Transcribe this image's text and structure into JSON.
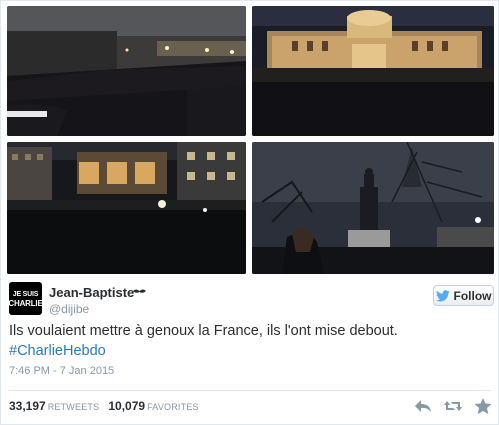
{
  "tweet": {
    "author_name": "Jean-Baptiste",
    "author_handle": "@dijibe",
    "avatar_line1": "JE SUIS",
    "avatar_line2": "CHARLIE",
    "follow_label": "Follow",
    "text": "Ils voulaient mettre à genoux la France, ils l'ont mise debout.",
    "hashtag": "#CharlieHebdo",
    "timestamp": "7:46 PM - 7 Jan 2015",
    "retweets_count": "33,197",
    "retweets_label": "RETWEETS",
    "favorites_count": "10,079",
    "favorites_label": "FAVORITES"
  },
  "photos": [
    {
      "subject": "crowd at night in street"
    },
    {
      "subject": "crowd in front of lit building"
    },
    {
      "subject": "crowd in square with buildings"
    },
    {
      "subject": "crowd around statue at night"
    }
  ],
  "icons": {
    "verified": "mustache-icon",
    "follow": "twitter-bird-icon",
    "reply": "reply-icon",
    "retweet": "retweet-icon",
    "favorite": "star-icon"
  },
  "colors": {
    "hashtag": "#2b7bb9",
    "muted": "#8899a6",
    "text": "#292f33",
    "twitter_blue": "#55acee"
  }
}
